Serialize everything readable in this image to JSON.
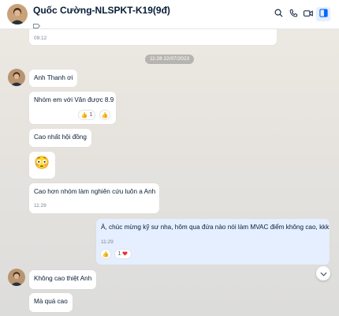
{
  "header": {
    "title": "Quốc Cường-NLSPKT-K19(9đ)"
  },
  "messages": {
    "m0_time": "09:12",
    "date_separator": "11:28 22/07/2023",
    "m1": "Anh Thanh ơi",
    "m2": "Nhóm em với Vân được 8.9",
    "m2_react_count": "1",
    "m3": "Cao nhất hội đồng",
    "m4_emoji": "😳",
    "m5": "Cao hơn nhóm làm nghiên cứu luôn a Anh",
    "m5_time": "11:29",
    "m6": "À, chúc mừng kỹ sư nha, hôm qua đứa nào nói làm MVAC điểm không cao, kkk",
    "m6_time": "11:29",
    "m6_react_count": "1",
    "m7": "Không cao thiệt Anh",
    "m8": "Mà quá cao"
  },
  "icons": {
    "search": "search-icon",
    "call": "phone-icon",
    "video": "video-icon",
    "panel": "panel-icon",
    "like": "thumbs-up-icon",
    "heart": "heart-icon",
    "scroll": "chevron-down-icon"
  },
  "colors": {
    "accent": "#0068ff",
    "my_bubble": "#e5efff",
    "heart": "#e5323b"
  }
}
